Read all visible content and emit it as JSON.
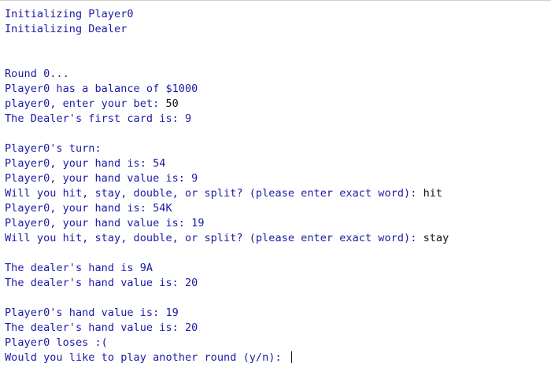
{
  "console": {
    "lines": [
      {
        "out": "Initializing Player0",
        "in": ""
      },
      {
        "out": "Initializing Dealer",
        "in": ""
      },
      null,
      null,
      {
        "out": "Round 0...",
        "in": ""
      },
      {
        "out": "Player0 has a balance of $1000",
        "in": ""
      },
      {
        "out": "player0, enter your bet: ",
        "in": "50"
      },
      {
        "out": "The Dealer's first card is: 9",
        "in": ""
      },
      null,
      {
        "out": "Player0's turn:",
        "in": ""
      },
      {
        "out": "Player0, your hand is: 54",
        "in": ""
      },
      {
        "out": "Player0, your hand value is: 9",
        "in": ""
      },
      {
        "out": "Will you hit, stay, double, or split? (please enter exact word): ",
        "in": "hit"
      },
      {
        "out": "Player0, your hand is: 54K",
        "in": ""
      },
      {
        "out": "Player0, your hand value is: 19",
        "in": ""
      },
      {
        "out": "Will you hit, stay, double, or split? (please enter exact word): ",
        "in": "stay"
      },
      null,
      {
        "out": "The dealer's hand is 9A",
        "in": ""
      },
      {
        "out": "The dealer's hand value is: 20",
        "in": ""
      },
      null,
      {
        "out": "Player0's hand value is: 19",
        "in": ""
      },
      {
        "out": "The dealer's hand value is: 20",
        "in": ""
      },
      {
        "out": "Player0 loses :(",
        "in": ""
      },
      {
        "out": "Would you like to play another round (y/n): ",
        "in": ""
      }
    ]
  },
  "colors": {
    "output_text": "#1a1aa6",
    "input_text": "#111111",
    "background": "#ffffff"
  }
}
